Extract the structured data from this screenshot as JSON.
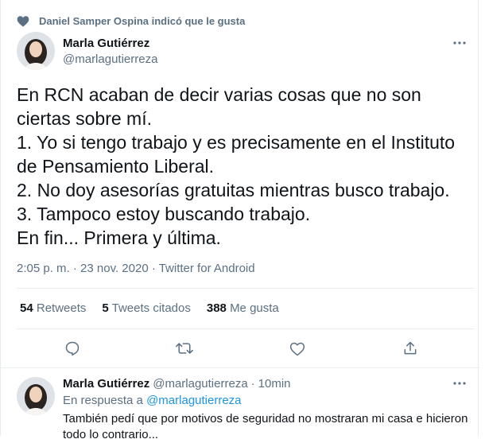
{
  "social_context": {
    "icon": "heart-icon",
    "text": "Daniel Samper Ospina indicó que le gusta"
  },
  "tweet": {
    "author_name": "Marla Gutiérrez",
    "author_handle": "@marlagutierreza",
    "text_lines": [
      "En RCN acaban de decir varias cosas que no son ciertas sobre mí.",
      "1. Yo si tengo trabajo y es precisamente en el Instituto de Pensamiento Liberal.",
      "2. No doy asesorías gratuitas mientras busco trabajo.",
      "3. Tampoco estoy buscando trabajo.",
      "En fin... Primera y última."
    ],
    "timestamp": "2:05 p. m. · 23 nov. 2020 · Twitter for Android",
    "stats": {
      "retweets_count": "54",
      "retweets_label": "Retweets",
      "quotes_count": "5",
      "quotes_label": "Tweets citados",
      "likes_count": "388",
      "likes_label": "Me gusta"
    },
    "actions": [
      "reply-icon",
      "retweet-icon",
      "like-icon",
      "share-icon"
    ]
  },
  "reply": {
    "author_name": "Marla Gutiérrez",
    "author_handle": "@marlagutierreza",
    "separator": "·",
    "time": "10min",
    "in_reply_prefix": "En respuesta a",
    "in_reply_handle": "@marlagutierreza",
    "text": "También pedí que por motivos de seguridad no mostraran mi casa e hicieron todo lo contrario..."
  },
  "colors": {
    "accent": "#1b95e0",
    "secondary_text": "#5b7083",
    "primary_text": "#0f1419",
    "divider": "#e6ecf0"
  }
}
